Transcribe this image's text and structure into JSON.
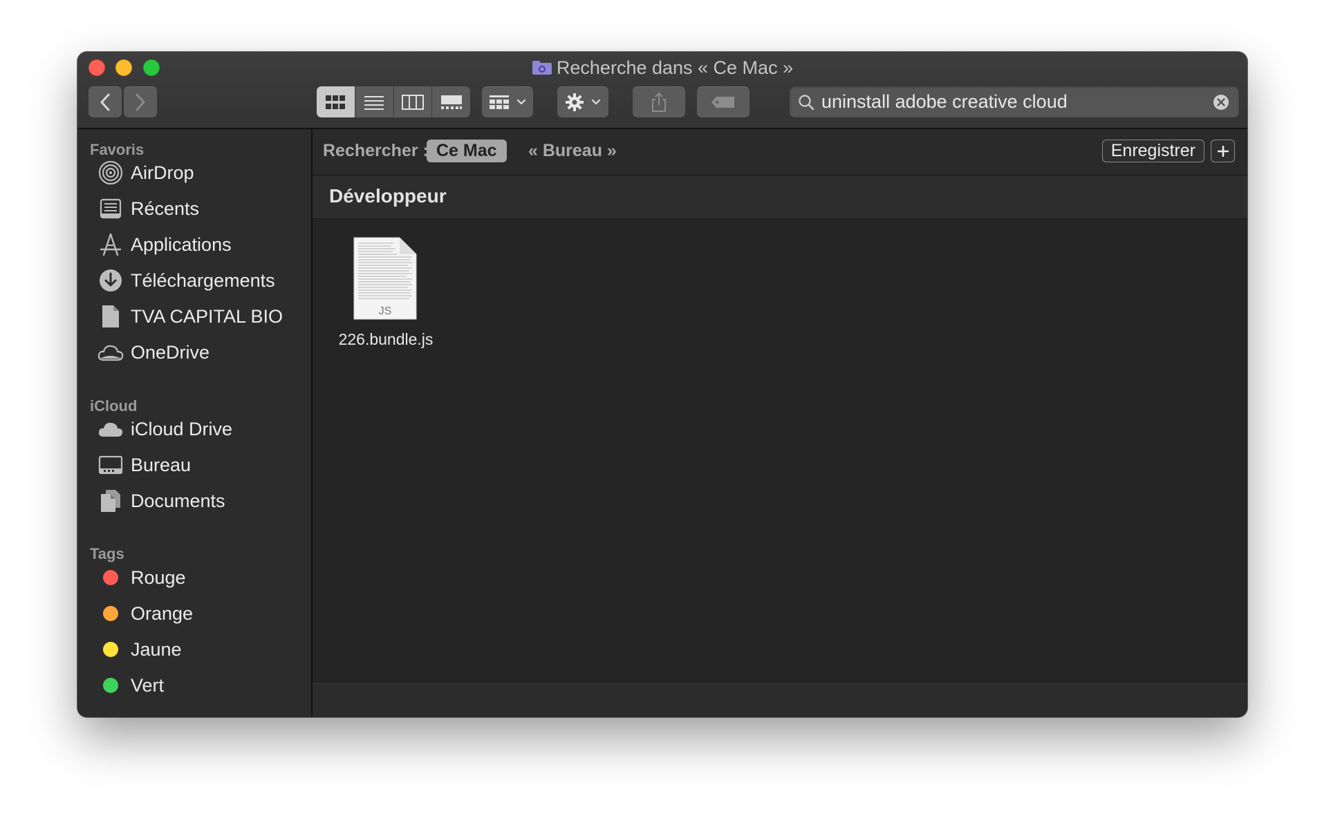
{
  "window": {
    "title": "Recherche dans « Ce Mac »"
  },
  "search": {
    "query": "uninstall adobe creative cloud"
  },
  "sidebar": {
    "favorites_title": "Favoris",
    "favorites": [
      {
        "label": "AirDrop",
        "icon": "airdrop-icon"
      },
      {
        "label": "Récents",
        "icon": "recents-icon"
      },
      {
        "label": "Applications",
        "icon": "applications-icon"
      },
      {
        "label": "Téléchargements",
        "icon": "downloads-icon"
      },
      {
        "label": "TVA CAPITAL BIO",
        "icon": "document-icon"
      },
      {
        "label": "OneDrive",
        "icon": "cloud-icon"
      }
    ],
    "icloud_title": "iCloud",
    "icloud": [
      {
        "label": "iCloud Drive",
        "icon": "icloud-icon"
      },
      {
        "label": "Bureau",
        "icon": "desktop-icon"
      },
      {
        "label": "Documents",
        "icon": "documents-icon"
      }
    ],
    "tags_title": "Tags",
    "tags": [
      {
        "label": "Rouge",
        "color": "#fe5b55"
      },
      {
        "label": "Orange",
        "color": "#fea53b"
      },
      {
        "label": "Jaune",
        "color": "#fde23a"
      },
      {
        "label": "Vert",
        "color": "#3ed35a"
      }
    ]
  },
  "scope": {
    "label": "Rechercher :",
    "selected": "Ce Mac",
    "other": "« Bureau »",
    "save_label": "Enregistrer"
  },
  "results": {
    "group_title": "Développeur",
    "files": [
      {
        "name": "226.bundle.js",
        "badge": "JS"
      }
    ]
  }
}
